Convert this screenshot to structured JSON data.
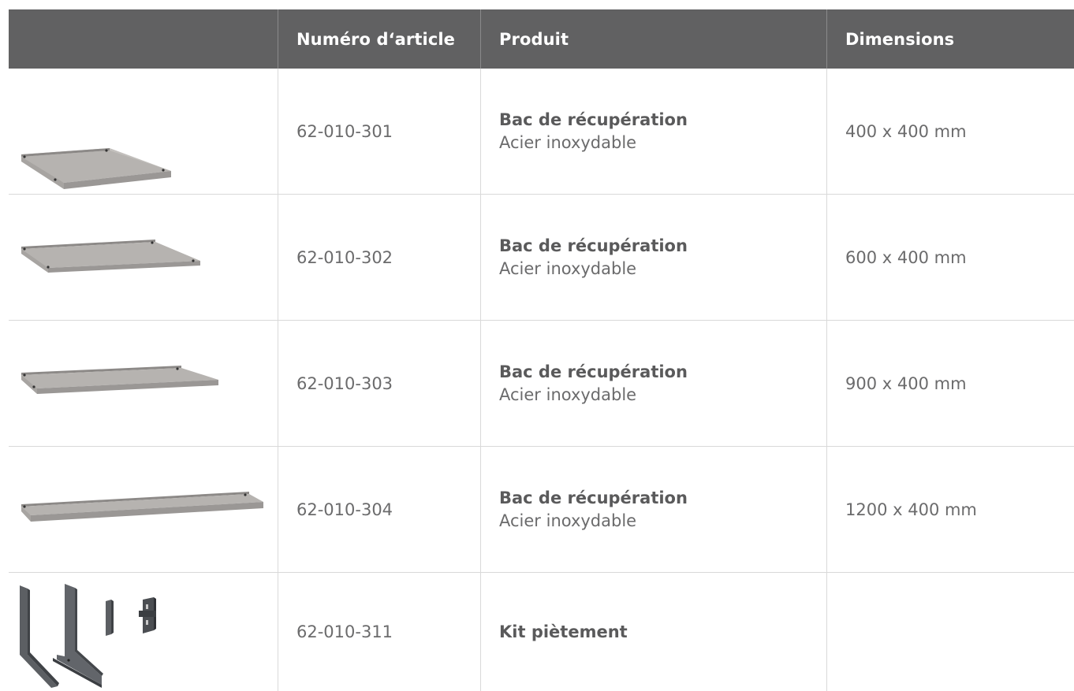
{
  "table": {
    "headers": [
      "",
      "Numéro d‘article",
      "Produit",
      "Dimensions"
    ],
    "rows": [
      {
        "image": "drip-tray-400-image",
        "article": "62-010-301",
        "product": "Bac de récupération",
        "material": "Acier inoxydable",
        "dimensions": "400 x 400 mm"
      },
      {
        "image": "drip-tray-600-image",
        "article": "62-010-302",
        "product": "Bac de récupération",
        "material": "Acier inoxydable",
        "dimensions": "600 x 400 mm"
      },
      {
        "image": "drip-tray-900-image",
        "article": "62-010-303",
        "product": "Bac de récupération",
        "material": "Acier inoxydable",
        "dimensions": "900 x 400 mm"
      },
      {
        "image": "drip-tray-1200-image",
        "article": "62-010-304",
        "product": "Bac de récupération",
        "material": "Acier inoxydable",
        "dimensions": "1200 x 400 mm"
      },
      {
        "image": "leg-kit-image",
        "article": "62-010-311",
        "product": "Kit piètement",
        "material": "",
        "dimensions": ""
      }
    ]
  },
  "colors": {
    "header_bg": "#616162",
    "header_text": "#ffffff",
    "body_text": "#6b6b6c",
    "divider": "#d9d9d9",
    "tray_metal": "#b1aeac",
    "leg_metal": "#5c5f63"
  }
}
